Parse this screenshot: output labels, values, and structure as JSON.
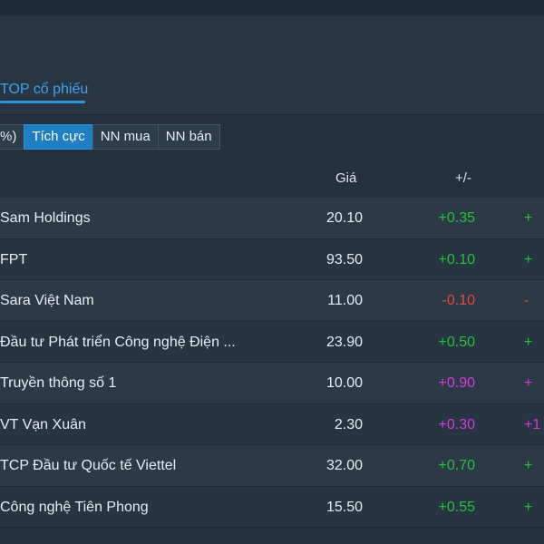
{
  "tab": {
    "title": "TOP cổ phiếu"
  },
  "filters": [
    {
      "label": "%)",
      "active": false
    },
    {
      "label": "Tích cực",
      "active": true
    },
    {
      "label": "NN mua",
      "active": false
    },
    {
      "label": "NN bán",
      "active": false
    }
  ],
  "table": {
    "headers": {
      "price": "Giá",
      "change": "+/-"
    },
    "rows": [
      {
        "name": "Sam Holdings",
        "price": "20.10",
        "change": "+0.35",
        "pct": "+",
        "color": "green"
      },
      {
        "name": "FPT",
        "price": "93.50",
        "change": "+0.10",
        "pct": "+",
        "color": "green"
      },
      {
        "name": "Sara Việt Nam",
        "price": "11.00",
        "change": "-0.10",
        "pct": "-",
        "color": "red"
      },
      {
        "name": "Đầu tư Phát triển Công nghệ Điện ...",
        "price": "23.90",
        "change": "+0.50",
        "pct": "+",
        "color": "green"
      },
      {
        "name": "Truyền thông số 1",
        "price": "10.00",
        "change": "+0.90",
        "pct": "+",
        "color": "purple"
      },
      {
        "name": "VT Vạn Xuân",
        "price": "2.30",
        "change": "+0.30",
        "pct": "+1",
        "color": "purple"
      },
      {
        "name": "TCP Đầu tư Quốc tế Viettel",
        "price": "32.00",
        "change": "+0.70",
        "pct": "+",
        "color": "green"
      },
      {
        "name": "Công nghệ Tiên Phong",
        "price": "15.50",
        "change": "+0.55",
        "pct": "+",
        "color": "green"
      }
    ]
  },
  "colors": {
    "accent": "#2f93dd",
    "up": "#25c23a",
    "down": "#e9483f",
    "ceiling": "#d63bd6"
  }
}
